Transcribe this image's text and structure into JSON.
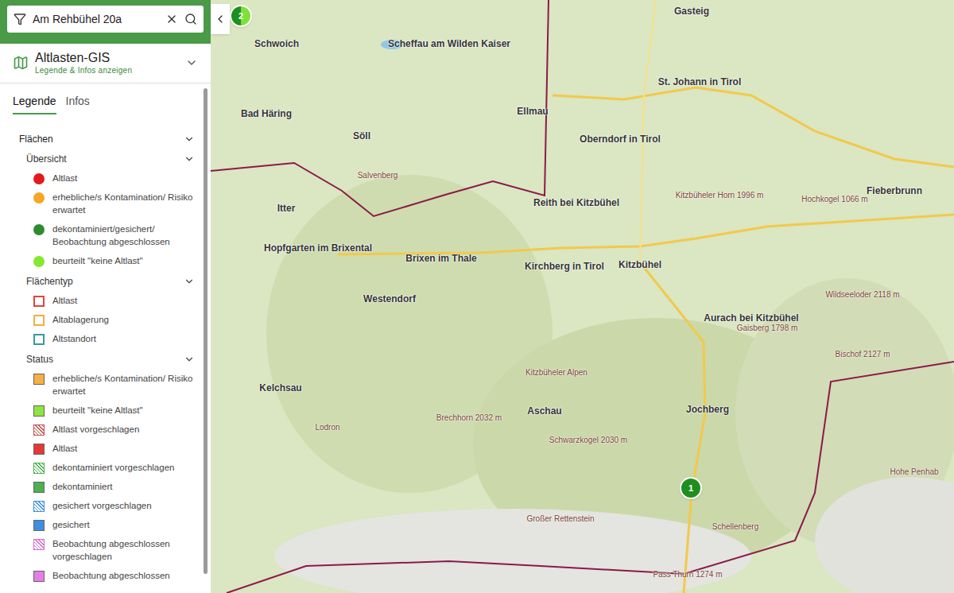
{
  "search": {
    "value": "Am Rehbühel 20a"
  },
  "app": {
    "title": "Altlasten-GIS",
    "subtitle": "Legende & Infos anzeigen",
    "expanded": false
  },
  "tabs": [
    {
      "label": "Legende",
      "selected": true
    },
    {
      "label": "Infos",
      "selected": false
    }
  ],
  "legend": {
    "title": "Flächen",
    "expanded": true,
    "groups": [
      {
        "title": "Übersicht",
        "expanded": true,
        "items": [
          {
            "label": "Altlast",
            "kind": "dot",
            "color": "#e31a1c"
          },
          {
            "label": "erhebliche/s Kontamination/ Risiko erwartet",
            "kind": "dot",
            "color": "#f5a623"
          },
          {
            "label": "dekontaminiert/gesichert/ Beobachtung abgeschlossen",
            "kind": "dot",
            "color": "#2e8b2e"
          },
          {
            "label": "beurteilt \"keine Altlast\"",
            "kind": "dot",
            "color": "#84e82e"
          }
        ]
      },
      {
        "title": "Flächentyp",
        "expanded": true,
        "items": [
          {
            "label": "Altlast",
            "kind": "outline",
            "color": "#e0453a"
          },
          {
            "label": "Altablagerung",
            "kind": "outline",
            "color": "#f0b040"
          },
          {
            "label": "Altstandort",
            "kind": "outline",
            "color": "#3a9a9a"
          }
        ]
      },
      {
        "title": "Status",
        "expanded": true,
        "items": [
          {
            "label": "erhebliche/s Kontamination/ Risiko erwartet",
            "kind": "filled",
            "color": "#f5b041"
          },
          {
            "label": "beurteilt \"keine Altlast\"",
            "kind": "filled",
            "color": "#8ee53f"
          },
          {
            "label": "Altlast vorgeschlagen",
            "kind": "hatched",
            "color": "#c05050"
          },
          {
            "label": "Altlast",
            "kind": "filled",
            "color": "#e53935"
          },
          {
            "label": "dekontaminiert vorgeschlagen",
            "kind": "hatched",
            "color": "#4caf50"
          },
          {
            "label": "dekontaminiert",
            "kind": "filled",
            "color": "#4caf50"
          },
          {
            "label": "gesichert vorgeschlagen",
            "kind": "hatched",
            "color": "#3f8fe0"
          },
          {
            "label": "gesichert",
            "kind": "filled",
            "color": "#3f8fe0"
          },
          {
            "label": "Beobachtung abgeschlossen vorgeschlagen",
            "kind": "hatched",
            "color": "#d070d0"
          },
          {
            "label": "Beobachtung abgeschlossen",
            "kind": "filled",
            "color": "#e67ee6"
          }
        ]
      }
    ]
  },
  "map": {
    "labels": [
      {
        "text": "Schwoich",
        "kind": "town"
      },
      {
        "text": "Bad Häring",
        "kind": "town"
      },
      {
        "text": "Söll",
        "kind": "town"
      },
      {
        "text": "Scheffau am Wilden Kaiser",
        "kind": "town"
      },
      {
        "text": "Ellmau",
        "kind": "town"
      },
      {
        "text": "St. Johann in Tirol",
        "kind": "town"
      },
      {
        "text": "Oberndorf in Tirol",
        "kind": "town"
      },
      {
        "text": "Reith bei Kitzbühel",
        "kind": "town"
      },
      {
        "text": "Itter",
        "kind": "town"
      },
      {
        "text": "Hopfgarten im Brixental",
        "kind": "town"
      },
      {
        "text": "Brixen im Thale",
        "kind": "town"
      },
      {
        "text": "Westendorf",
        "kind": "town"
      },
      {
        "text": "Kirchberg in Tirol",
        "kind": "town"
      },
      {
        "text": "Kitzbühel",
        "kind": "town"
      },
      {
        "text": "Aurach bei Kitzbühel",
        "kind": "town"
      },
      {
        "text": "Jochberg",
        "kind": "town"
      },
      {
        "text": "Fieberbrunn",
        "kind": "town"
      },
      {
        "text": "Kitzbüheler Horn 1996 m",
        "kind": "peak"
      },
      {
        "text": "Wildseeloder 2118 m",
        "kind": "peak"
      },
      {
        "text": "Gaisberg 1798 m",
        "kind": "peak"
      },
      {
        "text": "Bischof 2127 m",
        "kind": "peak"
      },
      {
        "text": "Brechhorn 2032 m",
        "kind": "peak"
      },
      {
        "text": "Schwarzkogel 2030 m",
        "kind": "peak"
      },
      {
        "text": "Großer Rettenstein",
        "kind": "peak"
      },
      {
        "text": "Hohe Penhab",
        "kind": "peak"
      },
      {
        "text": "Schellenberg",
        "kind": "peak"
      },
      {
        "text": "Pass Thurn 1274 m",
        "kind": "peak"
      },
      {
        "text": "Kitzbüheler Alpen",
        "kind": "peak"
      },
      {
        "text": "Salvenberg",
        "kind": "peak"
      },
      {
        "text": "Gasteig",
        "kind": "town"
      },
      {
        "text": "Hochkogel 1066 m",
        "kind": "peak"
      },
      {
        "text": "Lodron",
        "kind": "peak"
      },
      {
        "text": "Aschau",
        "kind": "town"
      },
      {
        "text": "Kelchsau",
        "kind": "town"
      }
    ],
    "markers": [
      {
        "count": "2",
        "colors": [
          "#1e8f1e",
          "#7ee03a"
        ]
      },
      {
        "count": "1",
        "colors": [
          "#1e8f1e"
        ]
      }
    ]
  }
}
